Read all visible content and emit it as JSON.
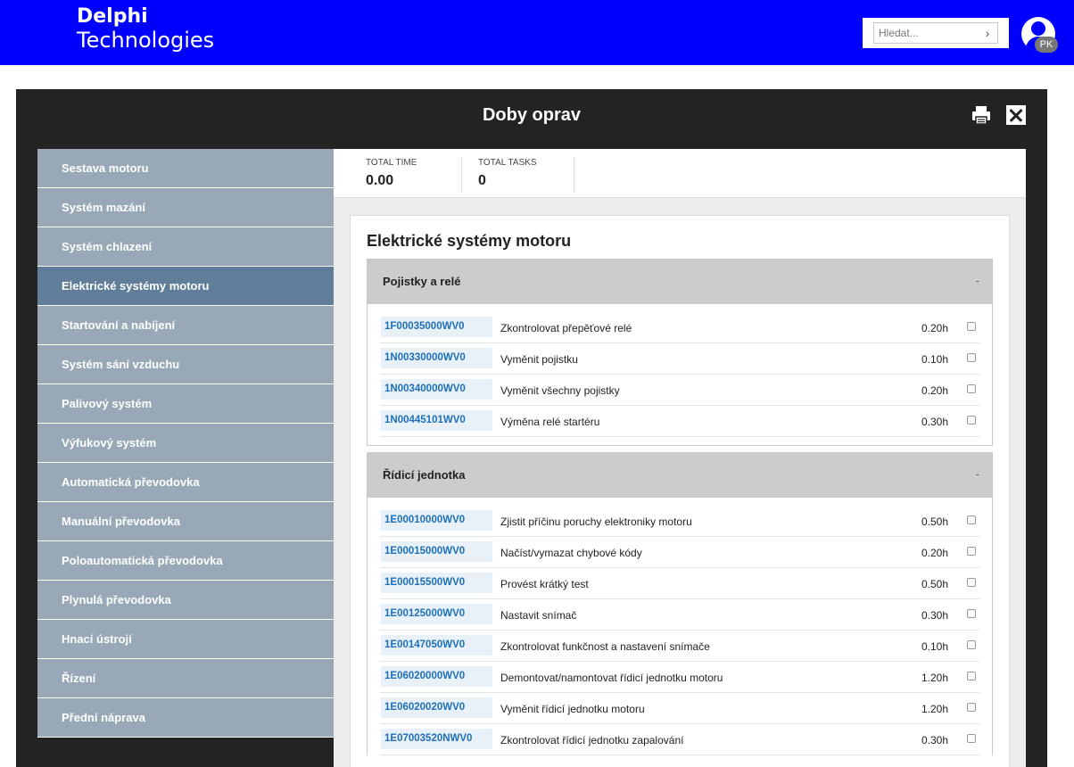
{
  "header": {
    "logo_line1": "Delphi",
    "logo_line2": "Technologies",
    "search_placeholder": "Hledat...",
    "avatar_initials": "PK",
    "background_color": "#0000ff"
  },
  "modal": {
    "title": "Doby oprav",
    "print_icon": "printer-icon",
    "close_icon": "close-icon"
  },
  "sidebar": {
    "items": [
      {
        "label": "Sestava motoru",
        "active": false
      },
      {
        "label": "Systém mazání",
        "active": false
      },
      {
        "label": "Systém chlazení",
        "active": false
      },
      {
        "label": "Elektrické systémy motoru",
        "active": true
      },
      {
        "label": "Startování a nabíjení",
        "active": false
      },
      {
        "label": "Systém sání vzduchu",
        "active": false
      },
      {
        "label": "Palivový systém",
        "active": false
      },
      {
        "label": "Výfukový systém",
        "active": false
      },
      {
        "label": "Automatická převodovka",
        "active": false
      },
      {
        "label": "Manuální převodovka",
        "active": false
      },
      {
        "label": "Poloautomatická převodovka",
        "active": false
      },
      {
        "label": "Plynulá převodovka",
        "active": false
      },
      {
        "label": "Hnací ústrojí",
        "active": false
      },
      {
        "label": "Řízení",
        "active": false
      },
      {
        "label": "Přední náprava",
        "active": false
      }
    ]
  },
  "stats": {
    "total_time_label": "TOTAL TIME",
    "total_time_value": "0.00",
    "total_tasks_label": "TOTAL TASKS",
    "total_tasks_value": "0"
  },
  "section": {
    "title": "Elektrické systémy motoru",
    "groups": [
      {
        "title": "Pojistky a relé",
        "toggle": "-",
        "rows": [
          {
            "code": "1F00035000WV0",
            "desc": "Zkontrolovat přepěťové relé",
            "time": "0.20h"
          },
          {
            "code": "1N00330000WV0",
            "desc": "Vyměnit pojistku",
            "time": "0.10h"
          },
          {
            "code": "1N00340000WV0",
            "desc": "Vyměnit všechny pojistky",
            "time": "0.20h"
          },
          {
            "code": "1N00445101WV0",
            "desc": "Výměna relé startéru",
            "time": "0.30h"
          }
        ]
      },
      {
        "title": "Řídicí jednotka",
        "toggle": "-",
        "rows": [
          {
            "code": "1E00010000WV0",
            "desc": "Zjistit příčinu poruchy elektroniky motoru",
            "time": "0.50h"
          },
          {
            "code": "1E00015000WV0",
            "desc": "Načíst/vymazat chybové kódy",
            "time": "0.20h"
          },
          {
            "code": "1E00015500WV0",
            "desc": "Provést krátký test",
            "time": "0.50h"
          },
          {
            "code": "1E00125000WV0",
            "desc": "Nastavit snímač",
            "time": "0.30h"
          },
          {
            "code": "1E00147050WV0",
            "desc": "Zkontrolovat funkčnost a nastavení snímače",
            "time": "0.10h"
          },
          {
            "code": "1E06020000WV0",
            "desc": "Demontovat/namontovat řídicí jednotku motoru",
            "time": "1.20h"
          },
          {
            "code": "1E06020020WV0",
            "desc": "Vyměnit řídicí jednotku motoru",
            "time": "1.20h"
          },
          {
            "code": "1E07003520NWV0",
            "desc": "Zkontrolovat řídicí jednotku zapalování",
            "time": "0.30h"
          }
        ]
      }
    ]
  }
}
